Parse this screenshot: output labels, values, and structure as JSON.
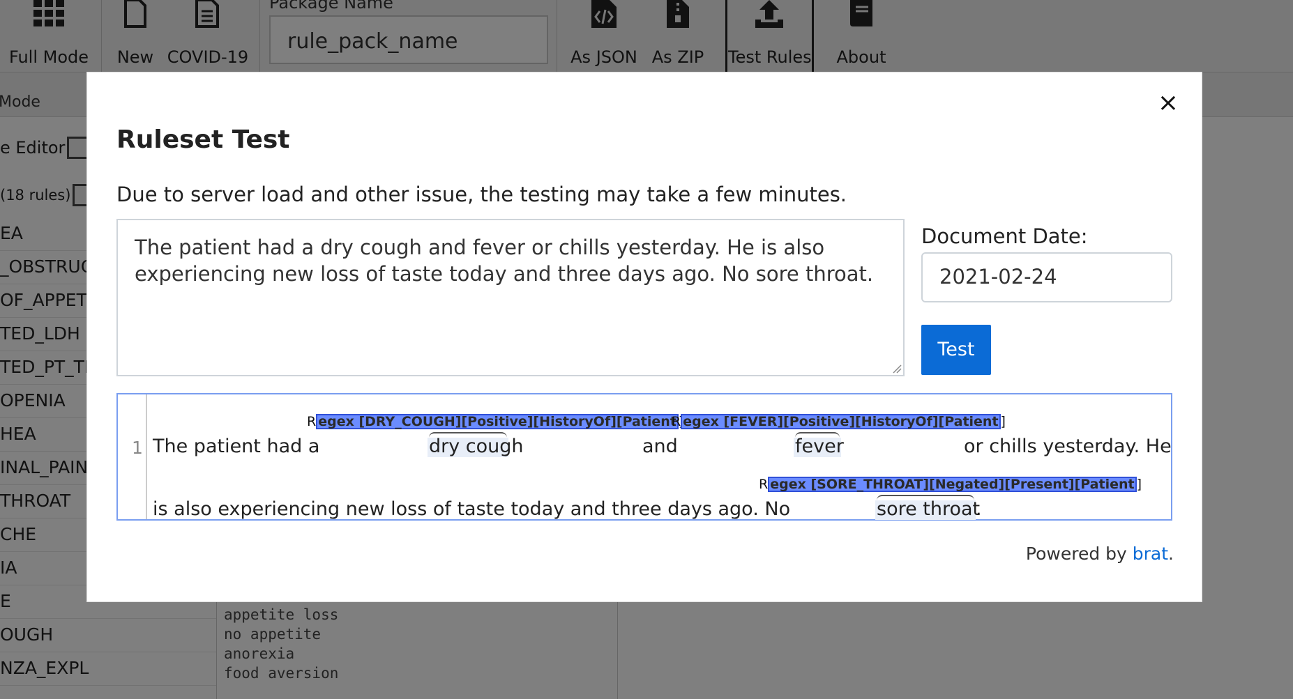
{
  "toolbar": {
    "full_mode": "Full Mode",
    "new": "New",
    "covid19": "COVID-19",
    "package_label": "Package Name",
    "package_value": "rule_pack_name",
    "as_json": "As JSON",
    "as_zip": "As ZIP",
    "test_rules": "Test Rules",
    "about": "About"
  },
  "subbar": {
    "mode": "Mode"
  },
  "sidebar": {
    "editor_label": "e Editor",
    "rules_count": "(18 rules)",
    "items": [
      "EA",
      "_OBSTRUC",
      "OF_APPET",
      "TED_LDH",
      "TED_PT_TI",
      "OPENIA",
      "HEA",
      "INAL_PAIN",
      "THROAT",
      "CHE",
      "IA",
      "E",
      "OUGH",
      "NZA_EXPL"
    ]
  },
  "editor_lines": [
    "appetite loss",
    "no appetite",
    "anorexia",
    "food aversion"
  ],
  "modal": {
    "title": "Ruleset Test",
    "note": "Due to server load and other issue, the testing may take a few minutes.",
    "text": "The patient had a dry cough and fever or chills yesterday. He is also experiencing new loss of taste today and three days ago. No sore throat.",
    "date_label": "Document Date:",
    "date_value": "2021-02-24",
    "test_button": "Test",
    "close": "×",
    "powered_by": "Powered by",
    "brat_link": "brat",
    "powered_suffix": "."
  },
  "brat": {
    "line_number": "1",
    "line1": {
      "seg1": "The patient had a",
      "span1": "dry cough",
      "seg2": "and",
      "span2": "fever",
      "seg3": "or chills yesterday. He"
    },
    "line2": {
      "seg1": "is also experiencing new loss of taste today and three days ago. No",
      "span1": "sore throat",
      "seg2": "."
    },
    "annotations": [
      {
        "pre": "R",
        "label": "egex [DRY_COUGH][Positive][HistoryOf][Patient",
        "post": "]"
      },
      {
        "pre": "R",
        "label": "egex [FEVER][Positive][HistoryOf][Patient",
        "post": "]"
      },
      {
        "pre": "R",
        "label": "egex [SORE_THROAT][Negated][Present][Patient",
        "post": "]"
      }
    ]
  },
  "colors": {
    "accent": "#0b6bd6",
    "annotation_fill": "#6b8cff",
    "brat_border": "#7a9ef0"
  }
}
